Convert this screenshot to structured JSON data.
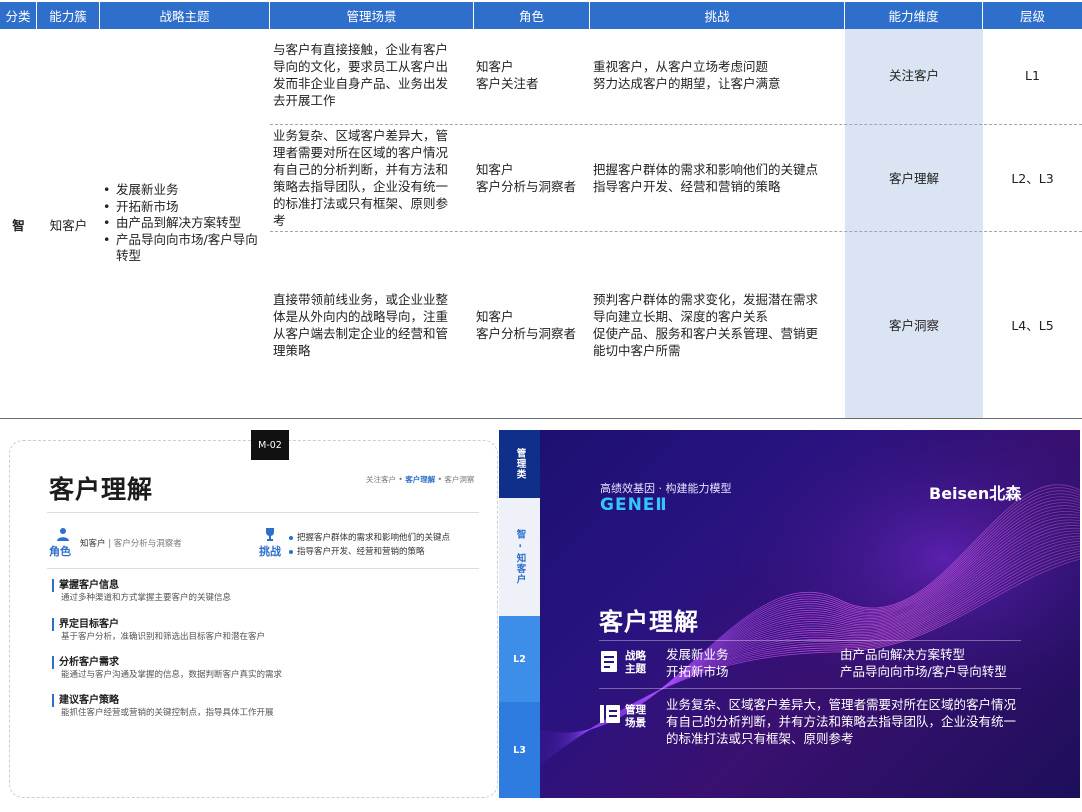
{
  "table": {
    "headers": [
      "分类",
      "能力簇",
      "战略主题",
      "管理场景",
      "角色",
      "挑战",
      "能力维度",
      "层级"
    ],
    "category": "智",
    "cluster": "知客户",
    "strategy_themes": [
      "发展新业务",
      "开拓新市场",
      "由产品到解决方案转型",
      "产品导向向市场/客户导向转型"
    ],
    "rows": [
      {
        "scene": "与客户有直接接触，企业有客户\n导向的文化，要求员工从客户出\n发而非企业自身产品、业务出发\n去开展工作",
        "role": "知客户\n客户关注者",
        "challenge": "重视客户，从客户立场考虑问题\n努力达成客户的期望，让客户满意",
        "dimension": "关注客户",
        "level": "L1"
      },
      {
        "scene": "业务复杂、区域客户差异大，管\n理者需要对所在区域的客户情况\n有自己的分析判断，并有方法和\n策略去指导团队，企业没有统一\n的标准打法或只有框架、原则参\n考",
        "role": "知客户\n客户分析与洞察者",
        "challenge": "把握客户群体的需求和影响他们的关键点\n指导客户开发、经营和营销的策略",
        "dimension": "客户理解",
        "level": "L2、L3"
      },
      {
        "scene": "直接带领前线业务，或企业业整\n体是从外向内的战略导向，注重\n从客户端去制定企业的经营和管\n理策略",
        "role": "知客户\n客户分析与洞察者",
        "challenge": "预判客户群体的需求变化，发掘潜在需求\n导向建立长期、深度的客户关系\n促使产品、服务和客户关系管理、营销更\n能切中客户所需",
        "dimension": "客户洞察",
        "level": "L4、L5"
      }
    ]
  },
  "card": {
    "tag": "M-02",
    "title": "客户理解",
    "breadcrumb": {
      "prev": "关注客户 • ",
      "active": "客户理解",
      "next": " • 客户洞察"
    },
    "role_label": "角色",
    "role_main": "知客户",
    "role_sub": "客户分析与洞察者",
    "challenge_label": "挑战",
    "challenges": [
      "把握客户群体的需求和影响他们的关键点",
      "指导客户开发、经营和营销的策略"
    ],
    "skills": [
      {
        "title": "掌握客户信息",
        "desc": "通过多种渠道和方式掌握主要客户的关键信息"
      },
      {
        "title": "界定目标客户",
        "desc": "基于客户分析，准确识别和筛选出目标客户和潜在客户"
      },
      {
        "title": "分析客户需求",
        "desc": "能通过与客户沟通及掌握的信息，数据判断客户真实的需求"
      },
      {
        "title": "建议客户策略",
        "desc": "能抓住客户经营或营销的关键控制点，指导具体工作开展"
      }
    ]
  },
  "banner": {
    "tabs": [
      "管理类",
      "智 - 知客户",
      "L2",
      "L3"
    ],
    "subtitle": "高绩效基因 · 构建能力模型",
    "gene": "GENEⅡ",
    "brand": "Beisen北森",
    "title": "客户理解",
    "strategy_label": "战略\n主题",
    "strategy_items": [
      "发展新业务",
      "由产品向解决方案转型",
      "开拓新市场",
      "产品导向向市场/客户导向转型"
    ],
    "scene_label": "管理\n场景",
    "scene_text": "业务复杂、区域客户差异大，管理者需要对所在区域的客户情况有自己的分析判断，并有方法和策略去指导团队，企业没有统一的标准打法或只有框架、原则参考"
  },
  "colors": {
    "header_blue": "#2f6fcc",
    "dimension_bg": "#dbe4f3",
    "banner_cyan": "#33c5ff"
  }
}
